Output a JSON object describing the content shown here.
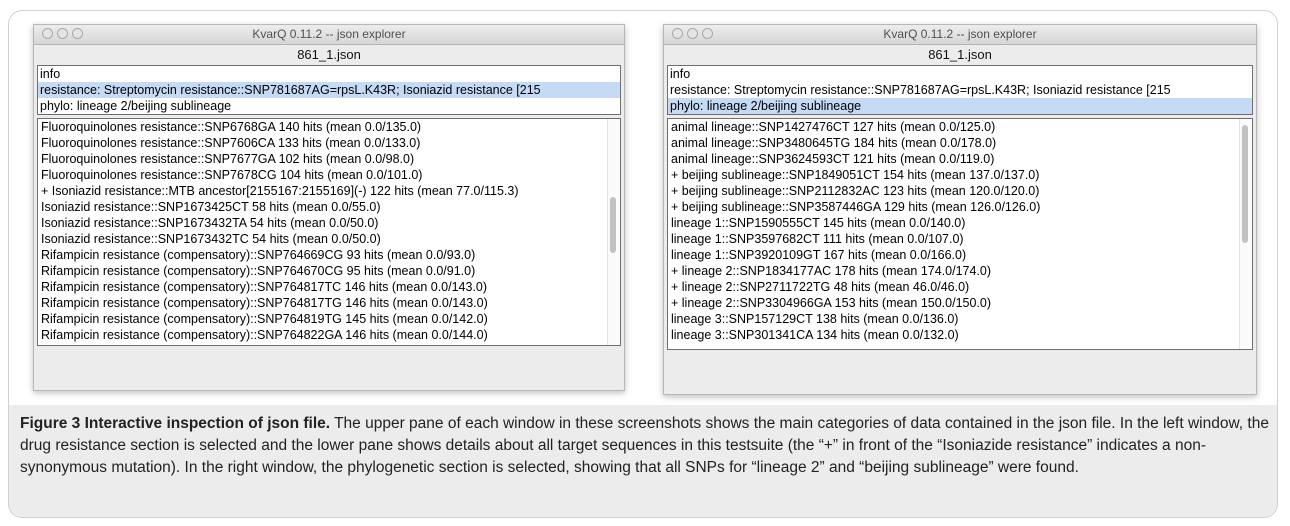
{
  "windows": [
    {
      "title": "KvarQ 0.11.2 -- json explorer",
      "filename": "861_1.json",
      "upper_rows": [
        "info",
        "resistance: Streptomycin resistance::SNP781687AG=rpsL.K43R; Isoniazid resistance [215",
        "phylo: lineage 2/beijing sublineage"
      ],
      "selected_index": 1,
      "lower_rows": [
        "Fluoroquinolones resistance::SNP6768GA 140 hits (mean 0.0/135.0)",
        "Fluoroquinolones resistance::SNP7606CA 133 hits (mean 0.0/133.0)",
        "Fluoroquinolones resistance::SNP7677GA 102 hits (mean 0.0/98.0)",
        "Fluoroquinolones resistance::SNP7678CG 104 hits (mean 0.0/101.0)",
        "+ Isoniazid resistance::MTB ancestor[2155167:2155169](-) 122 hits (mean 77.0/115.3)",
        "Isoniazid resistance::SNP1673425CT 58 hits (mean 0.0/55.0)",
        "Isoniazid resistance::SNP1673432TA 54 hits (mean 0.0/50.0)",
        "Isoniazid resistance::SNP1673432TC 54 hits (mean 0.0/50.0)",
        "Rifampicin resistance (compensatory)::SNP764669CG 93 hits (mean 0.0/93.0)",
        "Rifampicin resistance (compensatory)::SNP764670CG 95 hits (mean 0.0/91.0)",
        "Rifampicin resistance (compensatory)::SNP764817TC 146 hits (mean 0.0/143.0)",
        "Rifampicin resistance (compensatory)::SNP764817TG 146 hits (mean 0.0/143.0)",
        "Rifampicin resistance (compensatory)::SNP764819TG 145 hits (mean 0.0/142.0)",
        "Rifampicin resistance (compensatory)::SNP764822GA 146 hits (mean 0.0/144.0)"
      ]
    },
    {
      "title": "KvarQ 0.11.2 -- json explorer",
      "filename": "861_1.json",
      "upper_rows": [
        "info",
        "resistance: Streptomycin resistance::SNP781687AG=rpsL.K43R; Isoniazid resistance [215",
        "phylo: lineage 2/beijing sublineage"
      ],
      "selected_index": 2,
      "lower_rows": [
        "animal lineage::SNP1427476CT 127 hits (mean 0.0/125.0)",
        "animal lineage::SNP3480645TG 184 hits (mean 0.0/178.0)",
        "animal lineage::SNP3624593CT 121 hits (mean 0.0/119.0)",
        "+ beijing sublineage::SNP1849051CT 154 hits (mean 137.0/137.0)",
        "+ beijing sublineage::SNP2112832AC 123 hits (mean 120.0/120.0)",
        "+ beijing sublineage::SNP3587446GA 129 hits (mean 126.0/126.0)",
        "lineage 1::SNP1590555CT 145 hits (mean 0.0/140.0)",
        "lineage 1::SNP3597682CT 111 hits (mean 0.0/107.0)",
        "lineage 1::SNP3920109GT 167 hits (mean 0.0/166.0)",
        "+ lineage 2::SNP1834177AC 178 hits (mean 174.0/174.0)",
        "+ lineage 2::SNP2711722TG 48 hits (mean 46.0/46.0)",
        "+ lineage 2::SNP3304966GA 153 hits (mean 150.0/150.0)",
        "lineage 3::SNP157129CT 138 hits (mean 0.0/136.0)",
        "lineage 3::SNP301341CA 134 hits (mean 0.0/132.0)"
      ]
    }
  ],
  "caption": {
    "label": "Figure 3 Interactive inspection of json file.",
    "text": " The upper pane of each window in these screenshots shows the main categories of data contained in the json file. In the left window, the drug resistance section is selected and the lower pane shows details about all target sequences in this testsuite (the “+” in front of the “Isoniazide resistance” indicates a non-synonymous mutation). In the right window, the phylogenetic section is selected, showing that all SNPs for “lineage 2” and “beijing sublineage” were found."
  },
  "colors": {
    "selection": "#c4daf5",
    "window_bg": "#ececec"
  }
}
